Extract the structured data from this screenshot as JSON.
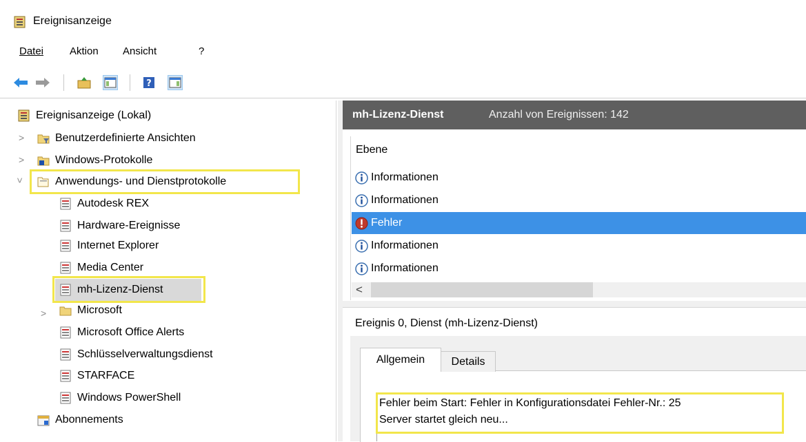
{
  "window": {
    "title": "Ereignisanzeige"
  },
  "menu": {
    "items": [
      {
        "label": "Datei"
      },
      {
        "label": "Aktion"
      },
      {
        "label": "Ansicht"
      },
      {
        "label": "?"
      }
    ]
  },
  "toolbar": {
    "buttons": [
      "back-arrow-icon",
      "forward-arrow-icon",
      "up-folder-icon",
      "show-hide-tree-icon",
      "help-icon",
      "action-pane-icon"
    ]
  },
  "tree": {
    "root": "Ereignisanzeige (Lokal)",
    "items": [
      {
        "label": "Benutzerdefinierte Ansichten",
        "expanded": false
      },
      {
        "label": "Windows-Protokolle",
        "expanded": false
      },
      {
        "label": "Anwendungs- und Dienstprotokolle",
        "expanded": true,
        "highlighted": true
      },
      {
        "label": "Autodesk REX"
      },
      {
        "label": "Hardware-Ereignisse"
      },
      {
        "label": "Internet Explorer"
      },
      {
        "label": "Media Center"
      },
      {
        "label": "mh-Lizenz-Dienst",
        "selected": true,
        "highlighted": true
      },
      {
        "label": "Microsoft",
        "expanded": false
      },
      {
        "label": "Microsoft Office Alerts"
      },
      {
        "label": "Schlüsselverwaltungsdienst"
      },
      {
        "label": "STARFACE"
      },
      {
        "label": "Windows PowerShell"
      },
      {
        "label": "Abonnements"
      }
    ]
  },
  "log": {
    "name": "mh-Lizenz-Dienst",
    "count_text": "Anzahl von Ereignissen: 142",
    "column_header": "Ebene",
    "events": [
      {
        "level": "Informationen",
        "type": "info"
      },
      {
        "level": "Informationen",
        "type": "info"
      },
      {
        "level": "Fehler",
        "type": "error",
        "selected": true
      },
      {
        "level": "Informationen",
        "type": "info"
      },
      {
        "level": "Informationen",
        "type": "info"
      }
    ],
    "scroll_left_arrow": "<"
  },
  "detail": {
    "title": "Ereignis 0, Dienst (mh-Lizenz-Dienst)",
    "tabs": [
      {
        "label": "Allgemein",
        "active": true
      },
      {
        "label": "Details",
        "active": false
      }
    ],
    "description_lines": [
      "Fehler beim Start: Fehler in Konfigurationsdatei Fehler-Nr.: 25",
      "Server startet gleich neu..."
    ]
  },
  "colors": {
    "highlight_box": "#f2e64b",
    "selection": "#3d91e6",
    "header_bg": "#5f5f5f"
  }
}
